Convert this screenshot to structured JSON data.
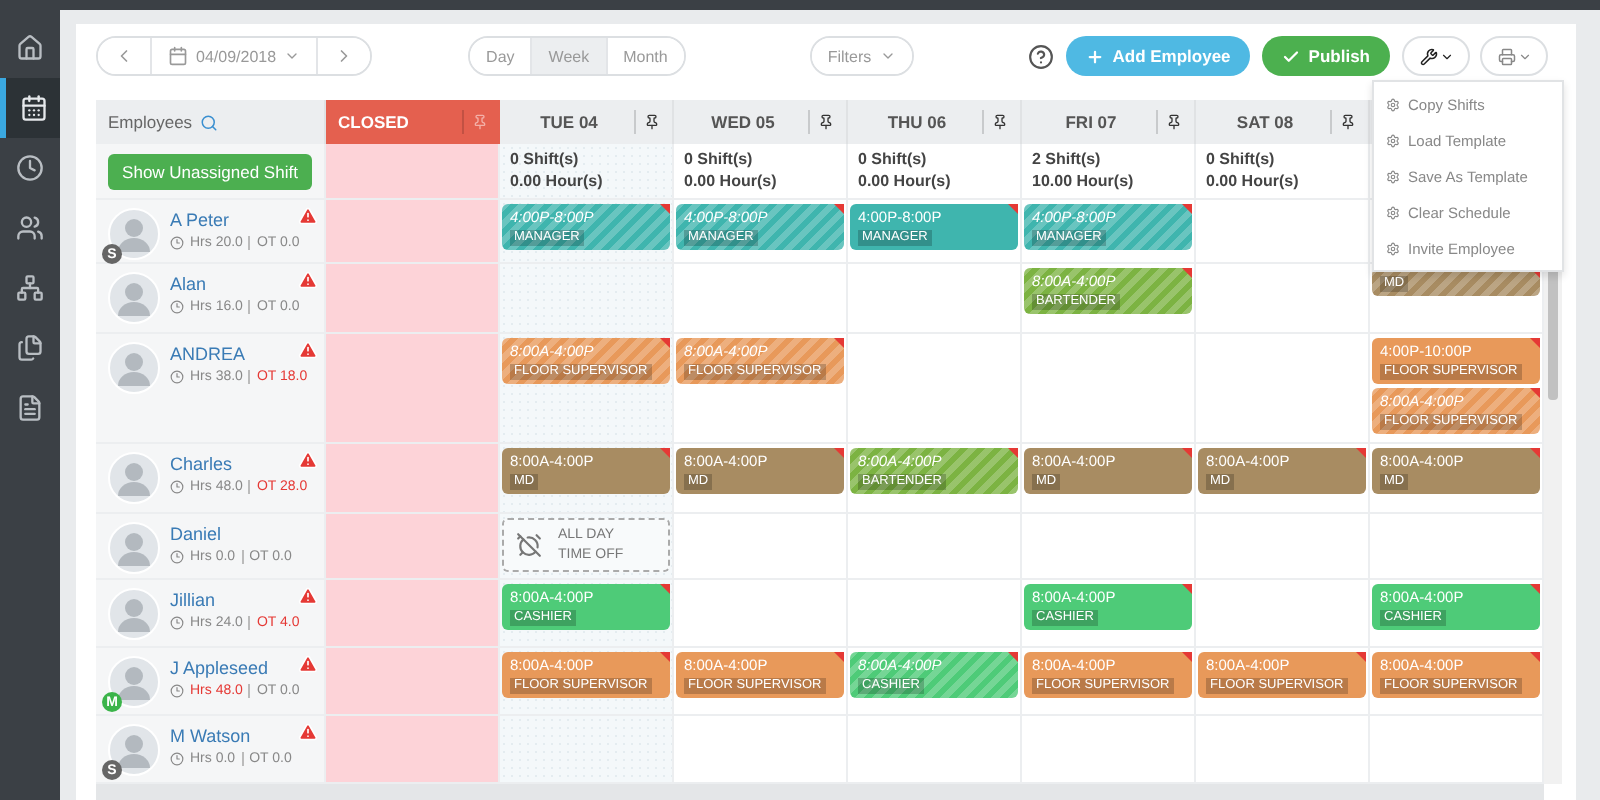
{
  "sidebar": {
    "items": [
      {
        "selected": false
      },
      {
        "selected": true
      },
      {
        "selected": false
      },
      {
        "selected": false
      },
      {
        "selected": false
      },
      {
        "selected": false
      },
      {
        "selected": false
      }
    ]
  },
  "toolbar": {
    "date": "04/09/2018",
    "views": [
      {
        "label": "Day",
        "selected": false
      },
      {
        "label": "Week",
        "selected": true
      },
      {
        "label": "Month",
        "selected": false
      }
    ],
    "filters": "Filters",
    "add_employee": "Add Employee",
    "publish": "Publish"
  },
  "tools_menu": {
    "items": [
      "Copy Shifts",
      "Load Template",
      "Save As Template",
      "Clear Schedule",
      "Invite Employee"
    ]
  },
  "schedule": {
    "employees_label": "Employees",
    "unassigned_button": "Show Unassigned Shift",
    "closed_label": "CLOSED",
    "days": [
      {
        "label": "TUE 04",
        "shifts": "0 Shift(s)",
        "hours": "0.00 Hour(s)",
        "today": true
      },
      {
        "label": "WED 05",
        "shifts": "0 Shift(s)",
        "hours": "0.00 Hour(s)",
        "today": false
      },
      {
        "label": "THU 06",
        "shifts": "0 Shift(s)",
        "hours": "0.00 Hour(s)",
        "today": false
      },
      {
        "label": "FRI 07",
        "shifts": "2 Shift(s)",
        "hours": "10.00 Hour(s)",
        "today": false
      },
      {
        "label": "SAT 08",
        "shifts": "0 Shift(s)",
        "hours": "0.00 Hour(s)",
        "today": false
      },
      {
        "today": false
      }
    ],
    "rows": [
      {
        "name": "A Peter",
        "badge": {
          "text": "S",
          "color": "#666666"
        },
        "warning": true,
        "hrs": "Hrs 20.0",
        "hrs_over": false,
        "ot": "OT 0.0",
        "ot_over": false,
        "cells": [
          {
            "kind": "shifts",
            "shifts": [
              {
                "kind": "shift",
                "time": "4:00P-8:00P",
                "role": "MANAGER",
                "color": "#3fb5ae",
                "striped": true
              }
            ]
          },
          {
            "kind": "shifts",
            "shifts": [
              {
                "kind": "shift",
                "time": "4:00P-8:00P",
                "role": "MANAGER",
                "color": "#3fb5ae",
                "striped": true
              }
            ]
          },
          {
            "kind": "shifts",
            "shifts": [
              {
                "kind": "shift",
                "time": "4:00P-8:00P",
                "role": "MANAGER",
                "color": "#3fb5ae",
                "striped": false
              }
            ]
          },
          {
            "kind": "shifts",
            "shifts": [
              {
                "kind": "shift",
                "time": "4:00P-8:00P",
                "role": "MANAGER",
                "color": "#3fb5ae",
                "striped": true
              }
            ]
          },
          {
            "kind": "blank"
          },
          {
            "kind": "blank"
          }
        ]
      },
      {
        "name": "Alan",
        "warning": true,
        "hrs": "Hrs 16.0",
        "hrs_over": false,
        "ot": "OT 0.0",
        "ot_over": false,
        "cells": [
          {
            "kind": "blank"
          },
          {
            "kind": "blank"
          },
          {
            "kind": "blank"
          },
          {
            "kind": "shifts",
            "shifts": [
              {
                "kind": "shift",
                "time": "8:00A-4:00P",
                "role": "BARTENDER",
                "color": "#7cb342",
                "striped": true
              }
            ]
          },
          {
            "kind": "blank"
          },
          {
            "kind": "shifts",
            "shifts": [
              {
                "kind": "shift",
                "role": "MD",
                "color": "#a88c62",
                "striped": true
              }
            ]
          }
        ]
      },
      {
        "name": "ANDREA",
        "warning": true,
        "hrs": "Hrs 38.0",
        "hrs_over": false,
        "ot": "OT 18.0",
        "ot_over": true,
        "cells": [
          {
            "kind": "shifts",
            "shifts": [
              {
                "kind": "shift",
                "time": "8:00A-4:00P",
                "role": "FLOOR SUPERVISOR",
                "color": "#e8995a",
                "striped": true
              }
            ]
          },
          {
            "kind": "shifts",
            "shifts": [
              {
                "kind": "shift",
                "time": "8:00A-4:00P",
                "role": "FLOOR SUPERVISOR",
                "color": "#e8995a",
                "striped": true
              }
            ]
          },
          {
            "kind": "blank"
          },
          {
            "kind": "blank"
          },
          {
            "kind": "blank"
          },
          {
            "kind": "shifts",
            "shifts": [
              {
                "kind": "shift",
                "time": "4:00P-10:00P",
                "role": "FLOOR SUPERVISOR",
                "color": "#e8995a",
                "striped": false
              },
              {
                "kind": "shift",
                "time": "8:00A-4:00P",
                "role": "FLOOR SUPERVISOR",
                "color": "#e8995a",
                "striped": true
              }
            ]
          }
        ]
      },
      {
        "name": "Charles",
        "warning": true,
        "hrs": "Hrs 48.0",
        "hrs_over": false,
        "ot": "OT 28.0",
        "ot_over": true,
        "cells": [
          {
            "kind": "shifts",
            "shifts": [
              {
                "kind": "shift",
                "time": "8:00A-4:00P",
                "role": "MD",
                "color": "#a88c62",
                "striped": false
              }
            ]
          },
          {
            "kind": "shifts",
            "shifts": [
              {
                "kind": "shift",
                "time": "8:00A-4:00P",
                "role": "MD",
                "color": "#a88c62",
                "striped": false
              }
            ]
          },
          {
            "kind": "shifts",
            "shifts": [
              {
                "kind": "shift",
                "time": "8:00A-4:00P",
                "role": "BARTENDER",
                "color": "#7cb342",
                "striped": true
              }
            ]
          },
          {
            "kind": "shifts",
            "shifts": [
              {
                "kind": "shift",
                "time": "8:00A-4:00P",
                "role": "MD",
                "color": "#a88c62",
                "striped": false
              }
            ]
          },
          {
            "kind": "shifts",
            "shifts": [
              {
                "kind": "shift",
                "time": "8:00A-4:00P",
                "role": "MD",
                "color": "#a88c62",
                "striped": false
              }
            ]
          },
          {
            "kind": "shifts",
            "shifts": [
              {
                "kind": "shift",
                "time": "8:00A-4:00P",
                "role": "MD",
                "color": "#a88c62",
                "striped": false
              }
            ]
          }
        ]
      },
      {
        "name": "Daniel",
        "warning": false,
        "hrs": "Hrs 0.0",
        "hrs_over": false,
        "ot": "OT 0.0",
        "ot_over": false,
        "cells": [
          {
            "kind": "shifts",
            "shifts": [
              {
                "kind": "time_off",
                "time": "ALL DAY",
                "role": "TIME OFF"
              }
            ]
          }
        ]
      },
      {
        "name": "Jillian",
        "warning": true,
        "hrs": "Hrs 24.0",
        "hrs_over": false,
        "ot": "OT 4.0",
        "ot_over": true,
        "cells": [
          {
            "kind": "shifts",
            "shifts": [
              {
                "kind": "shift",
                "time": "8:00A-4:00P",
                "role": "CASHIER",
                "color": "#4ecb78",
                "striped": false
              }
            ]
          },
          {
            "kind": "blank"
          },
          {
            "kind": "blank"
          },
          {
            "kind": "shifts",
            "shifts": [
              {
                "kind": "shift",
                "time": "8:00A-4:00P",
                "role": "CASHIER",
                "color": "#4ecb78",
                "striped": false
              }
            ]
          },
          {
            "kind": "blank"
          },
          {
            "kind": "shifts",
            "shifts": [
              {
                "kind": "shift",
                "time": "8:00A-4:00P",
                "role": "CASHIER",
                "color": "#4ecb78",
                "striped": false
              }
            ]
          }
        ]
      },
      {
        "name": "J Appleseed",
        "badge": {
          "text": "M",
          "color": "#3bb44a"
        },
        "warning": true,
        "hrs": "Hrs 48.0",
        "hrs_over": true,
        "ot": "OT 0.0",
        "ot_over": false,
        "cells": [
          {
            "kind": "shifts",
            "shifts": [
              {
                "kind": "shift",
                "time": "8:00A-4:00P",
                "role": "FLOOR SUPERVISOR",
                "color": "#e8995a",
                "striped": false
              }
            ]
          },
          {
            "kind": "shifts",
            "shifts": [
              {
                "kind": "shift",
                "time": "8:00A-4:00P",
                "role": "FLOOR SUPERVISOR",
                "color": "#e8995a",
                "striped": false
              }
            ]
          },
          {
            "kind": "shifts",
            "shifts": [
              {
                "kind": "shift",
                "time": "8:00A-4:00P",
                "role": "CASHIER",
                "color": "#4ecb78",
                "striped": true
              }
            ]
          },
          {
            "kind": "shifts",
            "shifts": [
              {
                "kind": "shift",
                "time": "8:00A-4:00P",
                "role": "FLOOR SUPERVISOR",
                "color": "#e8995a",
                "striped": false
              }
            ]
          },
          {
            "kind": "shifts",
            "shifts": [
              {
                "kind": "shift",
                "time": "8:00A-4:00P",
                "role": "FLOOR SUPERVISOR",
                "color": "#e8995a",
                "striped": false
              }
            ]
          },
          {
            "kind": "shifts",
            "shifts": [
              {
                "kind": "shift",
                "time": "8:00A-4:00P",
                "role": "FLOOR SUPERVISOR",
                "color": "#e8995a",
                "striped": false
              }
            ]
          }
        ]
      },
      {
        "name": "M Watson",
        "badge": {
          "text": "S",
          "color": "#666666"
        },
        "warning": true,
        "hrs": "Hrs 0.0",
        "hrs_over": false,
        "ot": "OT 0.0",
        "ot_over": false
      }
    ]
  }
}
